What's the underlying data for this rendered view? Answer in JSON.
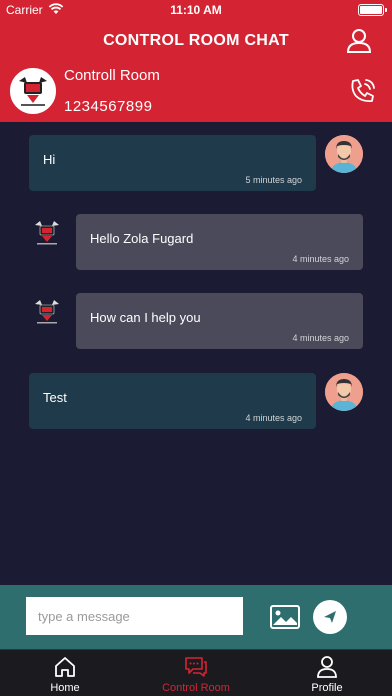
{
  "status_bar": {
    "carrier": "Carrier",
    "time": "11:10 AM"
  },
  "header": {
    "title": "CONTROL ROOM CHAT",
    "room_name": "Controll Room",
    "room_phone": "1234567899"
  },
  "messages": [
    {
      "direction": "out",
      "text": "Hi",
      "time": "5 minutes ago"
    },
    {
      "direction": "in",
      "text": "Hello Zola Fugard",
      "time": "4 minutes ago"
    },
    {
      "direction": "in",
      "text": "How can I help you",
      "time": "4 minutes ago"
    },
    {
      "direction": "out",
      "text": "Test",
      "time": "4 minutes ago"
    }
  ],
  "composer": {
    "placeholder": "type a message"
  },
  "tabs": [
    {
      "label": "Home",
      "icon": "home-icon",
      "active": false
    },
    {
      "label": "Control Room",
      "icon": "chat-icon",
      "active": true
    },
    {
      "label": "Profile",
      "icon": "user-icon",
      "active": false
    }
  ],
  "colors": {
    "accent": "#d42433",
    "chat_bg": "#1b1b33",
    "outgoing_bubble": "#1f3a4a",
    "incoming_bubble": "#4a4a5a",
    "composer_bg": "#2e6e6e",
    "tabbar_bg": "#1b1b1f"
  }
}
